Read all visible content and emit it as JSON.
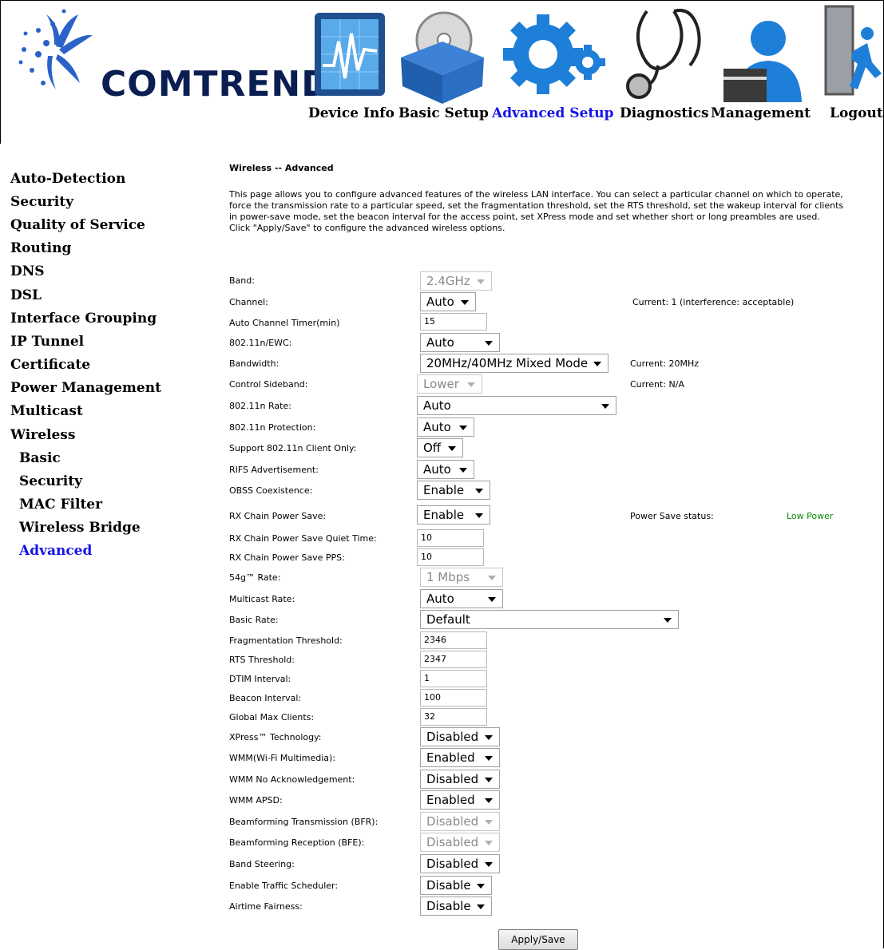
{
  "brand": {
    "name": "COMTREND"
  },
  "top_menu": [
    {
      "label": "Device Info",
      "icon": "chart-monitor-icon"
    },
    {
      "label": "Basic Setup",
      "icon": "box-disc-icon"
    },
    {
      "label": "Advanced Setup",
      "icon": "gears-icon",
      "active": true
    },
    {
      "label": "Diagnostics",
      "icon": "stethoscope-icon"
    },
    {
      "label": "Management",
      "icon": "user-laptop-icon"
    },
    {
      "label": "Logout",
      "icon": "exit-door-icon"
    }
  ],
  "left_nav": {
    "items": [
      "Auto-Detection",
      "Security",
      "Quality of Service",
      "Routing",
      "DNS",
      "DSL",
      "Interface Grouping",
      "IP Tunnel",
      "Certificate",
      "Power Management",
      "Multicast",
      "Wireless"
    ],
    "wireless_sub": [
      "Basic",
      "Security",
      "MAC Filter",
      "Wireless Bridge",
      "Advanced"
    ],
    "active": "Advanced"
  },
  "page": {
    "title": "Wireless -- Advanced",
    "desc1": "This page allows you to configure advanced features of the wireless LAN interface. You can select a particular channel on which to operate, force the transmission rate to a particular speed, set the fragmentation threshold, set the RTS threshold, set the wakeup interval for clients in power-save mode, set the beacon interval for the access point, set XPress mode and set whether short or long preambles are used.",
    "desc2": "Click \"Apply/Save\" to configure the advanced wireless options.",
    "apply_label": "Apply/Save"
  },
  "fields": {
    "band": {
      "label": "Band:",
      "value": "2.4GHz"
    },
    "channel": {
      "label": "Channel:",
      "value": "Auto",
      "note": "Current: 1 (interference: acceptable)"
    },
    "auto_channel_timer": {
      "label": "Auto Channel Timer(min)",
      "value": "15"
    },
    "ewc": {
      "label": "802.11n/EWC:",
      "value": "Auto"
    },
    "bandwidth": {
      "label": "Bandwidth:",
      "value": "20MHz/40MHz Mixed Mode",
      "note": "Current: 20MHz"
    },
    "control_sideband": {
      "label": "Control Sideband:",
      "value": "Lower",
      "note": "Current: N/A"
    },
    "n_rate": {
      "label": "802.11n Rate:",
      "value": "Auto"
    },
    "n_protection": {
      "label": "802.11n Protection:",
      "value": "Auto"
    },
    "n_client_only": {
      "label": "Support 802.11n Client Only:",
      "value": "Off"
    },
    "rifs": {
      "label": "RIFS Advertisement:",
      "value": "Auto"
    },
    "obss": {
      "label": "OBSS Coexistence:",
      "value": "Enable"
    },
    "rx_chain_ps": {
      "label": "RX Chain Power Save:",
      "value": "Enable",
      "note": "Power Save status:",
      "status": "Low Power"
    },
    "rx_quiet": {
      "label": "RX Chain Power Save Quiet Time:",
      "value": "10"
    },
    "rx_pps": {
      "label": "RX Chain Power Save PPS:",
      "value": "10"
    },
    "g_rate": {
      "label": "54g™ Rate:",
      "value": "1 Mbps"
    },
    "multicast_rate": {
      "label": "Multicast Rate:",
      "value": "Auto"
    },
    "basic_rate": {
      "label": "Basic Rate:",
      "value": "Default"
    },
    "frag": {
      "label": "Fragmentation Threshold:",
      "value": "2346"
    },
    "rts": {
      "label": "RTS Threshold:",
      "value": "2347"
    },
    "dtim": {
      "label": "DTIM Interval:",
      "value": "1"
    },
    "beacon": {
      "label": "Beacon Interval:",
      "value": "100"
    },
    "max_clients": {
      "label": "Global Max Clients:",
      "value": "32"
    },
    "xpress": {
      "label": "XPress™ Technology:",
      "value": "Disabled"
    },
    "wmm": {
      "label": "WMM(Wi-Fi Multimedia):",
      "value": "Enabled"
    },
    "wmm_noack": {
      "label": "WMM No Acknowledgement:",
      "value": "Disabled"
    },
    "wmm_apsd": {
      "label": "WMM APSD:",
      "value": "Enabled"
    },
    "bfr": {
      "label": "Beamforming Transmission (BFR):",
      "value": "Disabled"
    },
    "bfe": {
      "label": "Beamforming Reception (BFE):",
      "value": "Disabled"
    },
    "band_steering": {
      "label": "Band Steering:",
      "value": "Disabled"
    },
    "traffic_sched": {
      "label": "Enable Traffic Scheduler:",
      "value": "Disable"
    },
    "airtime": {
      "label": "Airtime Fairness:",
      "value": "Disable"
    }
  },
  "colors": {
    "active_link": "#1414e6",
    "status_green": "#0a8a0a"
  }
}
